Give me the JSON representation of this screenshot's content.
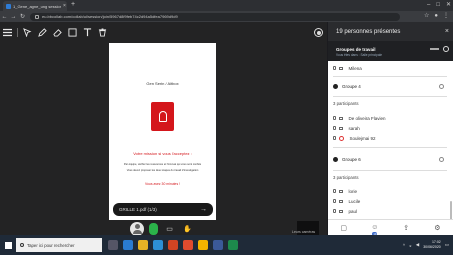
{
  "browser": {
    "tab_title": "1_Gene_agne_ung session",
    "url": "eu.bbcollab.com/collab/ui/session/join/5967d8f9feb74c2d94a5dfea7969d9d9",
    "new_tab_glyph": "+",
    "close_glyph": "×"
  },
  "document": {
    "title": "Gen Serin / Aitbox",
    "heading": "Votre mission si vous l'acceptez :",
    "line1": "Par équipe, vérifier les ressources et l'innovat qui vous sont confiés",
    "line2": "Vous devez proposer les deux étapes du travail d'investigation",
    "time": "Vous avez 30 minutes !",
    "footer": "Etape 1 : Considérez la grille d'analyse"
  },
  "pager": {
    "label": "GRILLE 1.pdf  (1/3)",
    "arrow": "→"
  },
  "camera_label": "Leurs caméras",
  "panel": {
    "title": "19 personnes présentes",
    "close": "×",
    "group_title": "Groupes de travail",
    "group_sub": "Vous êtes dans : Salle principale",
    "rows": {
      "milena": "Milena",
      "groupe4": "Groupe 4",
      "count4": "3 participants",
      "p1": "De oliveira Flavien",
      "p2": "sarah",
      "p3": "Soulejmai 92",
      "groupe6": "Groupe 6",
      "count6": "3 participants",
      "p4": "lorie",
      "p5": "Lucile",
      "p6": "paul"
    },
    "footer_badge": "19"
  },
  "taskbar": {
    "search_placeholder": "Taper ici pour rechercher",
    "time": "17:02",
    "date": "30/06/2020"
  },
  "colors": {
    "accent_red": "#d4161b",
    "mic_green": "#2bb34a",
    "collab_blue": "#3a69c9"
  },
  "icons": [
    "menu-icon",
    "pointer-icon",
    "pen-icon",
    "eraser-icon",
    "square-icon",
    "text-icon",
    "delete-icon",
    "record-icon",
    "microphone-icon",
    "camera-icon",
    "hand-icon",
    "share-icon",
    "chat-icon",
    "participants-icon",
    "settings-icon",
    "windows-start-icon"
  ]
}
